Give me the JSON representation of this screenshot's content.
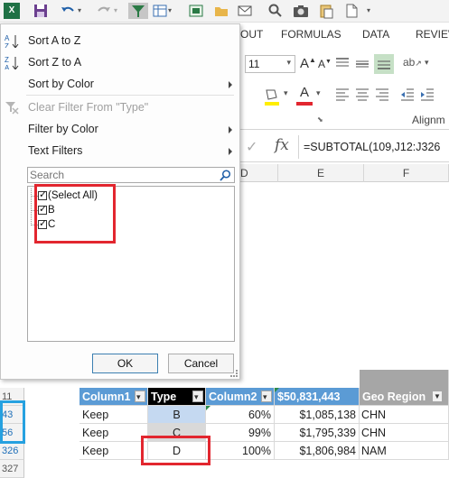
{
  "colors": {
    "excel_green": "#1f7145",
    "header_blue": "#5b9bd5",
    "highlight_red": "#e2262f",
    "highlight_blue": "#26a1e0"
  },
  "qat_icons": [
    "excel-logo-icon",
    "save-icon",
    "undo-icon",
    "redo-icon",
    "filter-icon",
    "form-icon",
    "screenshot-icon",
    "folder-icon",
    "email-icon",
    "search-icon",
    "camera-icon",
    "paste-icon",
    "new-document-icon"
  ],
  "ribbon": {
    "tabs": [
      "OUT",
      "FORMULAS",
      "DATA",
      "REVIEW"
    ],
    "font_size": "11",
    "alignment_label": "Alignm"
  },
  "formula_bar": {
    "fx_label": "fx",
    "formula": "=SUBTOTAL(109,J12:J326"
  },
  "columns": [
    "D",
    "E",
    "F"
  ],
  "filter_menu": {
    "sort_az": "Sort A to Z",
    "sort_za": "Sort Z to A",
    "sort_by_color": "Sort by Color",
    "clear_filter": "Clear Filter From \"Type\"",
    "filter_by_color": "Filter by Color",
    "text_filters": "Text Filters",
    "search_placeholder": "Search",
    "items": [
      "(Select All)",
      "B",
      "C"
    ],
    "ok": "OK",
    "cancel": "Cancel"
  },
  "grid": {
    "row_numbers": [
      "11",
      "43",
      "56",
      "326",
      "327"
    ],
    "headers": [
      "Column1",
      "Type",
      "Column2",
      "$50,831,443",
      "Geo Region"
    ],
    "rows": [
      [
        "Keep",
        "B",
        "60%",
        "$1,085,138",
        "CHN"
      ],
      [
        "Keep",
        "C",
        "99%",
        "$1,795,339",
        "CHN"
      ],
      [
        "Keep",
        "D",
        "100%",
        "$1,806,984",
        "NAM"
      ]
    ]
  }
}
